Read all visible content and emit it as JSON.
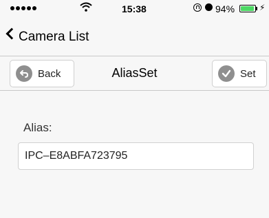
{
  "status_bar": {
    "time": "15:38",
    "battery_percent": "94%",
    "battery_level": 0.94,
    "icons": [
      "signal-dots-icon",
      "wifi-icon",
      "rotation-lock-icon",
      "alarm-icon",
      "battery-icon",
      "charging-bolt-icon"
    ]
  },
  "nav": {
    "back_label": "Camera List"
  },
  "toolbar": {
    "back_label": "Back",
    "title": "AliasSet",
    "set_label": "Set"
  },
  "form": {
    "alias_label": "Alias:",
    "alias_value": "IPC–E8ABFA723795"
  },
  "colors": {
    "background": "#f7f7f7",
    "icon_gray": "#8f8f8f",
    "battery_green": "#4cd964"
  }
}
